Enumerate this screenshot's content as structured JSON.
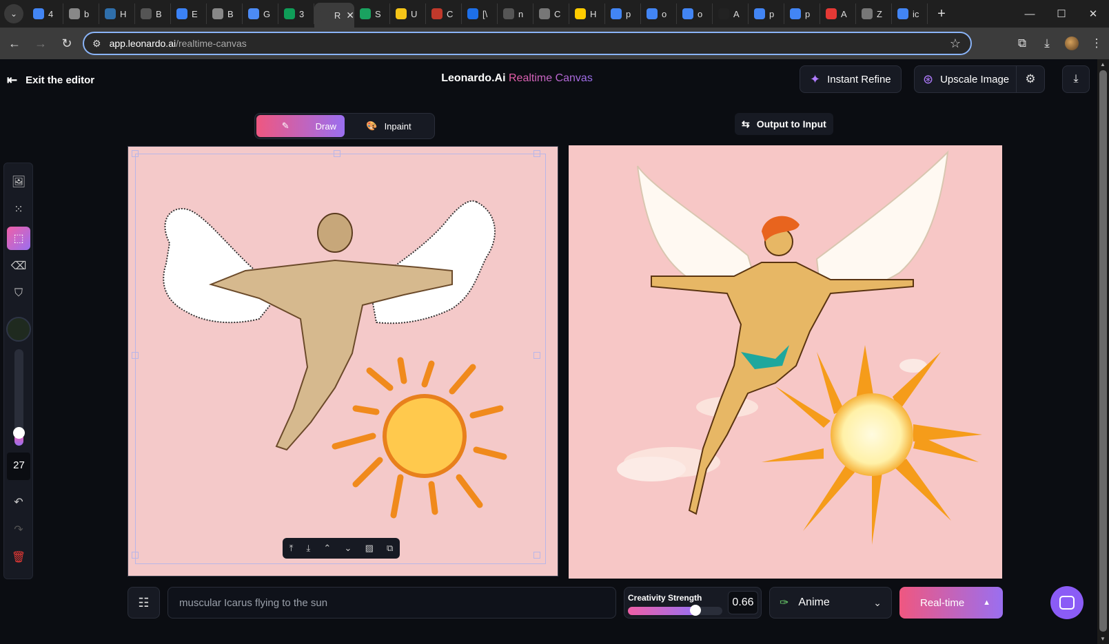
{
  "browser": {
    "tabs": [
      {
        "label": "4",
        "color": "#4285f4"
      },
      {
        "label": "b",
        "color": "#888888"
      },
      {
        "label": "H",
        "color": "#2f6fab"
      },
      {
        "label": "B",
        "color": "#555555"
      },
      {
        "label": "E",
        "color": "#3b82f6"
      },
      {
        "label": "B",
        "color": "#888888"
      },
      {
        "label": "G",
        "color": "#4c8bf5"
      },
      {
        "label": "3",
        "color": "#0f9d58"
      },
      {
        "label": "R",
        "color": "#3c3c3c",
        "active": true
      },
      {
        "label": "S",
        "color": "#1aa260"
      },
      {
        "label": "U",
        "color": "#f5c518"
      },
      {
        "label": "C",
        "color": "#c0392b"
      },
      {
        "label": "[\\",
        "color": "#1d6fe8"
      },
      {
        "label": "n",
        "color": "#555555"
      },
      {
        "label": "C",
        "color": "#777777"
      },
      {
        "label": "H",
        "color": "#ffcc00"
      },
      {
        "label": "p",
        "color": "#4285f4"
      },
      {
        "label": "o",
        "color": "#4285f4"
      },
      {
        "label": "o",
        "color": "#4285f4"
      },
      {
        "label": "A",
        "color": "#222222"
      },
      {
        "label": "p",
        "color": "#4285f4"
      },
      {
        "label": "p",
        "color": "#4285f4"
      },
      {
        "label": "A",
        "color": "#e53935"
      },
      {
        "label": "Z",
        "color": "#777777"
      },
      {
        "label": "ic",
        "color": "#4285f4"
      }
    ],
    "url_host": "app.leonardo.ai",
    "url_path": "/realtime-canvas"
  },
  "header": {
    "exit_label": "Exit the editor",
    "brand_name": "Leonardo.Ai",
    "brand_product": "Realtime Canvas",
    "instant_refine_label": "Instant Refine",
    "upscale_label": "Upscale Image"
  },
  "modes": {
    "draw_label": "Draw",
    "inpaint_label": "Inpaint",
    "output_to_input_label": "Output to Input"
  },
  "tools": {
    "brush_size": "27"
  },
  "prompt": {
    "text": "muscular Icarus flying to the sun"
  },
  "creativity": {
    "label": "Creativity Strength",
    "value": "0.66",
    "fraction": 0.66
  },
  "style": {
    "selected": "Anime"
  },
  "generate": {
    "label": "Real-time"
  },
  "colors": {
    "accent_start": "#ef5780",
    "accent_end": "#9a6ff0",
    "canvas_bg": "#f4c9c9"
  }
}
